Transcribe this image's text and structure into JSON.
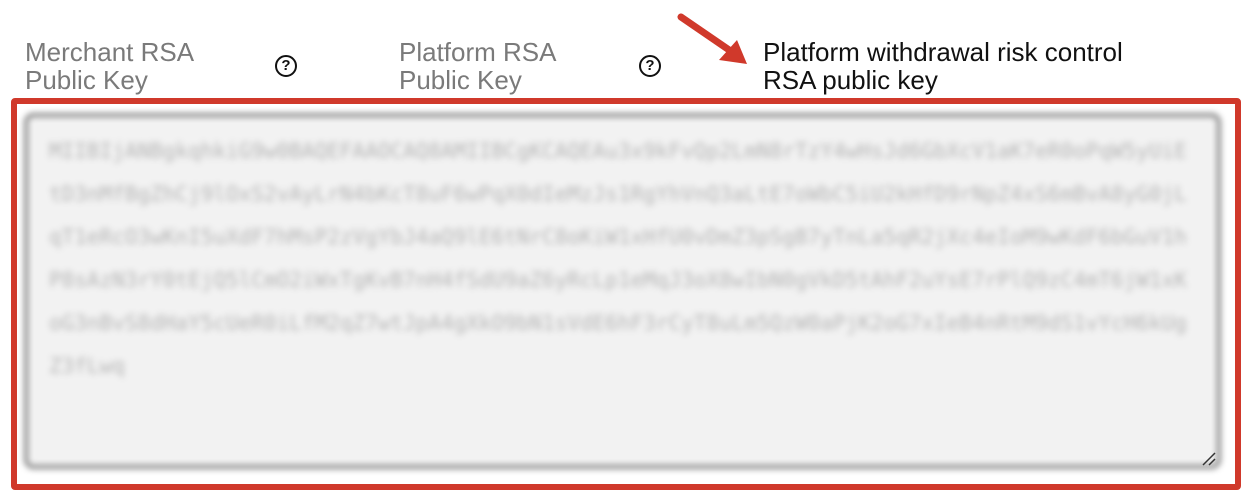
{
  "tabs": [
    {
      "label": "Merchant RSA\nPublic Key",
      "active": false,
      "icon": "question-circle-icon"
    },
    {
      "label": "Platform RSA\nPublic Key",
      "active": false,
      "icon": "question-circle-icon"
    },
    {
      "label": "Platform withdrawal risk control\nRSA public key",
      "active": true
    }
  ],
  "help_icon_glyph": "?",
  "key_field": {
    "value": "MIIBIjANBgkqhkiG9w0BAQEFAAOCAQ8AMIIBCgKCAQEAu3x9kFvQp2LmN8rTzY4wHsJd6GbXcV1aK7eR0oPqW5yUiEtD3nMfBgZhCj9lOxS2vAyLrN4bKcT8uF6wPqX0dIeMzJs1RgYhVnQ3aLtE7oWbC5iU2kHfD9rNpZ4xS6mBvA8yG0jLqT1eRcO3wKnI5uXdF7hMsP2zVgYbJ4aQ9lE6tNrC8oKiW1xHfU0vDmZ3pSgB7yTnLa5qR2jXc4eIoM9wKdF6bGuV1hP8sAzN3rY0tEjQ5lCmO2iWxTgKvB7nH4fSdU9aZ6yRcLp1eMqJ3oX8wIbN0gVkD5tAhF2uYsE7rPlQ9zC4mT6jW1xKoG3nBvS8dHaY5cUeR0iLfM2qZ7wtJpA4gXkO9bN1sVdE6hF3rCyT8uLm5QzW0aPjK2oG7xIeB4nRtM9dS1vYcH6kUgZ3fLwq"
  },
  "colors": {
    "highlight": "#d0392b",
    "field_background": "#f2f2f2",
    "inactive_label": "#7a7a7a",
    "active_label": "#111111"
  }
}
